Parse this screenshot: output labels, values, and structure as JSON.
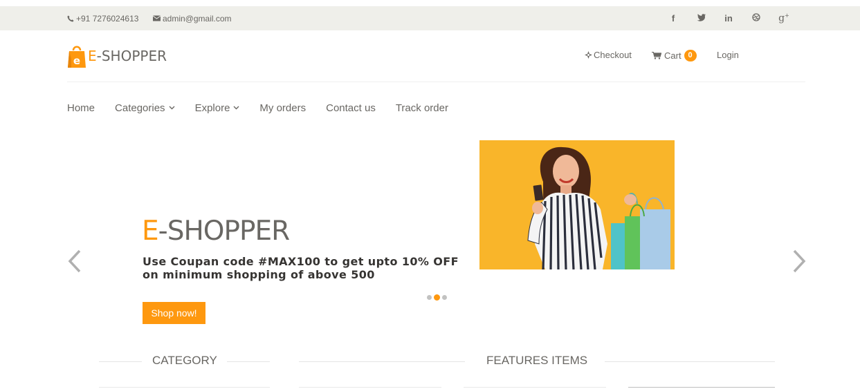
{
  "topbar": {
    "phone": "+91 7276024613",
    "email": "admin@gmail.com",
    "socials": [
      "f",
      "y",
      "in",
      "dribbble",
      "g+"
    ]
  },
  "logo": {
    "letter": "E",
    "rest": "-SHOPPER",
    "badge_letter": "e"
  },
  "header": {
    "checkout": "Checkout",
    "cart": "Cart",
    "cart_count": "0",
    "login": "Login"
  },
  "nav": {
    "items": [
      "Home",
      "Categories",
      "Explore",
      "My orders",
      "Contact us",
      "Track order"
    ]
  },
  "hero": {
    "title_letter": "E",
    "title_rest": "-SHOPPER",
    "text": "Use Coupan code #MAX100 to get upto 10% OFF on minimum shopping of above 500",
    "button": "Shop now!",
    "slides": 3,
    "active_slide": 2
  },
  "sections": {
    "category": "CATEGORY",
    "features": "FEATURES ITEMS"
  },
  "colors": {
    "accent": "#fe980f",
    "topbar_bg": "#efefea",
    "text": "#696763",
    "hero_image_bg": "#f9b52a"
  },
  "icons": [
    "phone-icon",
    "envelope-icon",
    "facebook-icon",
    "twitter-icon",
    "linkedin-icon",
    "dribbble-icon",
    "google-plus-icon",
    "crosshair-icon",
    "cart-icon",
    "chevron-down-icon",
    "chevron-left-icon",
    "chevron-right-icon",
    "shopping-bag-icon"
  ]
}
